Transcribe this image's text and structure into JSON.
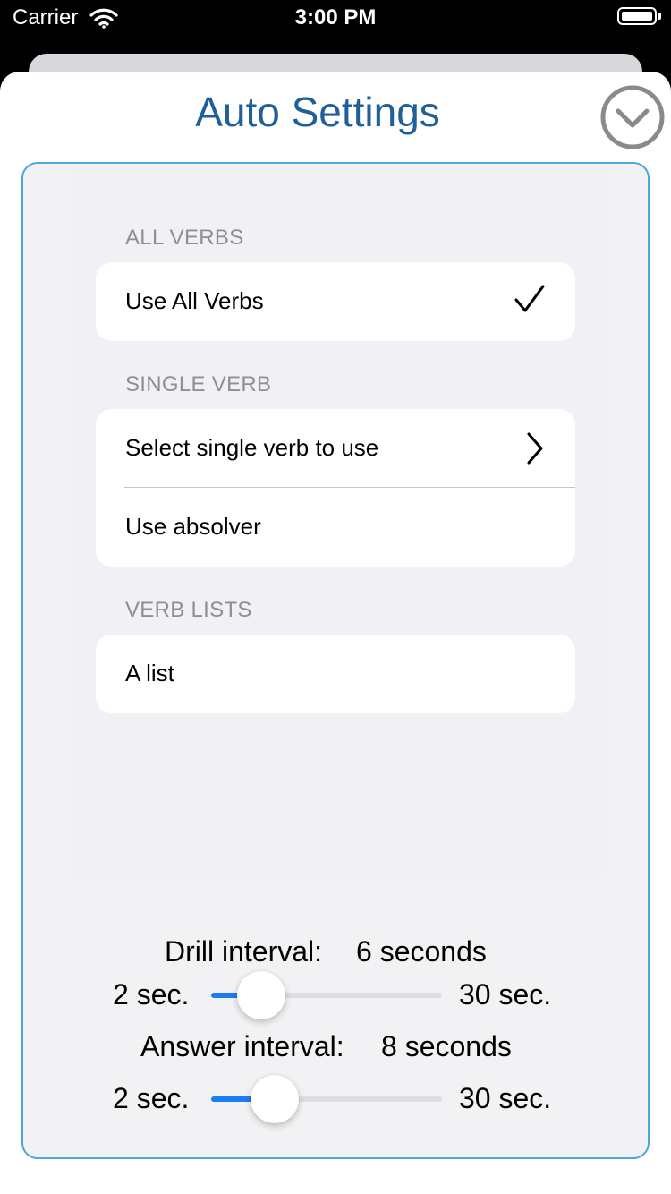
{
  "status_bar": {
    "carrier": "Carrier",
    "time": "3:00 PM",
    "battery_level": 1.0
  },
  "header": {
    "title": "Auto Settings",
    "dismiss_icon": "chevron-down-circle-icon"
  },
  "sections": {
    "all_verbs": {
      "header": "ALL VERBS",
      "item": {
        "label": "Use All Verbs",
        "checked": true
      }
    },
    "single_verb": {
      "header": "SINGLE VERB",
      "items": [
        {
          "label": "Select single verb to use",
          "accessory": "chevron-right-icon"
        },
        {
          "label": "Use absolver"
        }
      ]
    },
    "verb_lists": {
      "header": "VERB LISTS",
      "item": {
        "label": "A list"
      }
    }
  },
  "drill": {
    "label": "Drill interval:",
    "value_text": "6 seconds",
    "min_text": "2 sec.",
    "max_text": "30 sec.",
    "min": 2,
    "max": 30,
    "value": 6
  },
  "answer": {
    "label": "Answer interval:",
    "value_text": "8 seconds",
    "min_text": "2 sec.",
    "max_text": "30 sec.",
    "min": 2,
    "max": 30,
    "value": 8
  },
  "colors": {
    "title": "#1f5f9a",
    "panel_border": "#4ba7dc",
    "slider_fill": "#1a7ef2"
  }
}
